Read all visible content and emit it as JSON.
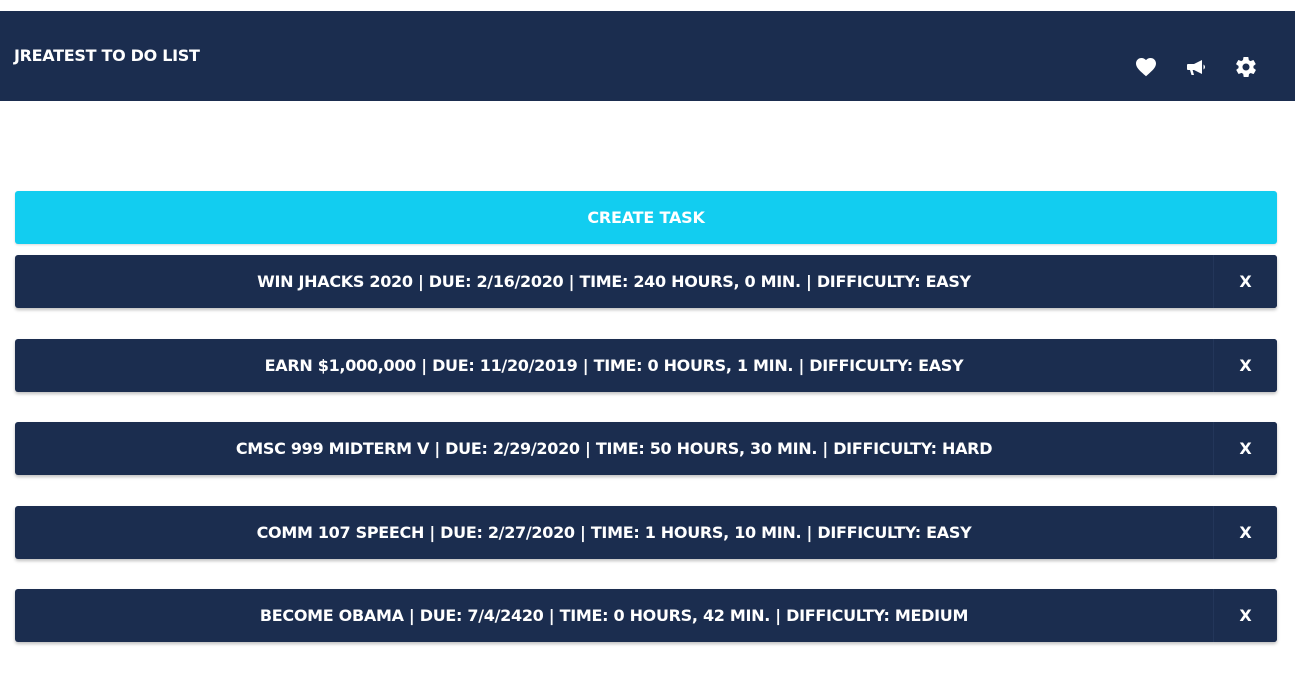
{
  "header": {
    "title": "JREATEST TO DO LIST",
    "icons": [
      "heart-icon",
      "megaphone-icon",
      "gear-icon"
    ]
  },
  "create_button": {
    "label": "CREATE TASK"
  },
  "tasks": [
    {
      "text": "WIN JHACKS 2020 | DUE: 2/16/2020 | TIME: 240 HOURS, 0 MIN. | DIFFICULTY: EASY",
      "delete_label": "X"
    },
    {
      "text": "EARN $1,000,000 | DUE: 11/20/2019 | TIME: 0 HOURS, 1 MIN. | DIFFICULTY: EASY",
      "delete_label": "X"
    },
    {
      "text": "CMSC 999 MIDTERM V | DUE: 2/29/2020 | TIME: 50 HOURS, 30 MIN. | DIFFICULTY: HARD",
      "delete_label": "X"
    },
    {
      "text": "COMM 107 SPEECH | DUE: 2/27/2020 | TIME: 1 HOURS, 10 MIN. | DIFFICULTY: EASY",
      "delete_label": "X"
    },
    {
      "text": "BECOME OBAMA | DUE: 7/4/2420 | TIME: 0 HOURS, 42 MIN. | DIFFICULTY: MEDIUM",
      "delete_label": "X"
    }
  ],
  "colors": {
    "navbar": "#1b2d4f",
    "accent": "#12cdf0",
    "text": "#ffffff"
  }
}
